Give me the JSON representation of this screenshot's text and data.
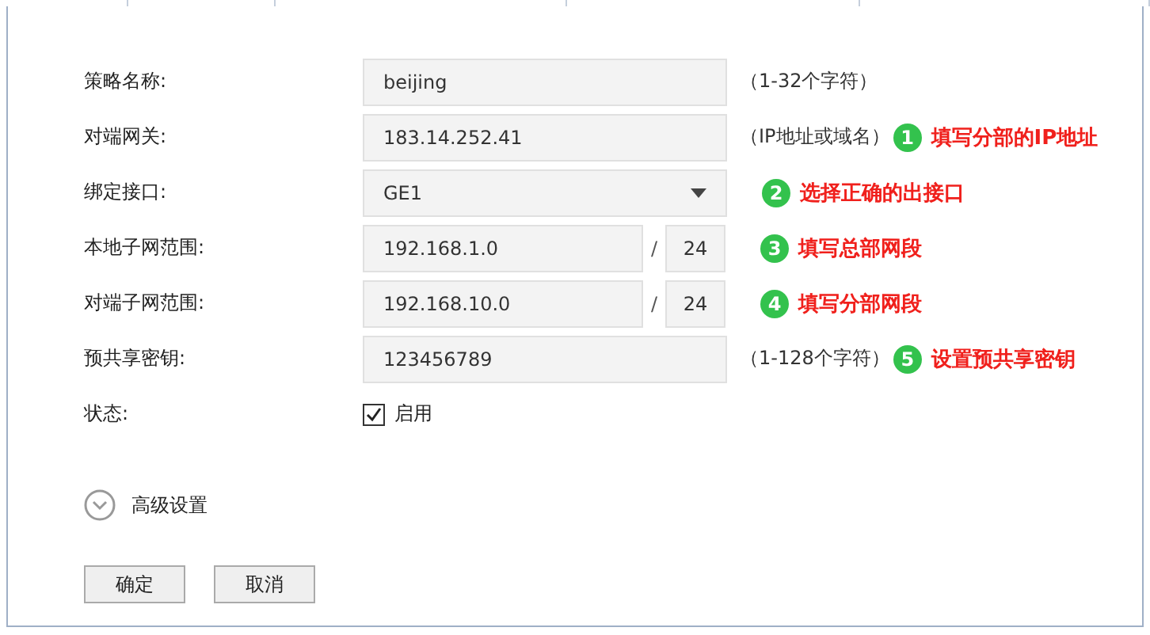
{
  "fields": [
    {
      "kind": "text",
      "label": "策略名称:",
      "value": "beijing",
      "hint": "（1-32个字符）"
    },
    {
      "kind": "text",
      "label": "对端网关:",
      "value": "183.14.252.41",
      "hint": "（IP地址或域名）",
      "note": {
        "number": "1",
        "text": "填写分部的IP地址"
      }
    },
    {
      "kind": "select",
      "label": "绑定接口:",
      "value": "GE1",
      "note": {
        "number": "2",
        "text": "选择正确的出接口"
      }
    },
    {
      "kind": "subnet",
      "label": "本地子网范围:",
      "value": "192.168.1.0",
      "separator": "/",
      "mask": "24",
      "note": {
        "number": "3",
        "text": "填写总部网段"
      }
    },
    {
      "kind": "subnet",
      "label": "对端子网范围:",
      "value": "192.168.10.0",
      "separator": "/",
      "mask": "24",
      "note": {
        "number": "4",
        "text": "填写分部网段"
      }
    },
    {
      "kind": "text",
      "label": "预共享密钥:",
      "value": "123456789",
      "hint": "（1-128个字符）",
      "note": {
        "number": "5",
        "text": "设置预共享密钥"
      }
    },
    {
      "kind": "checkbox",
      "label": "状态:",
      "checked": true,
      "option": "启用"
    }
  ],
  "advanced": {
    "label": "高级设置",
    "expanded": false
  },
  "buttons": [
    "确定",
    "取消"
  ]
}
